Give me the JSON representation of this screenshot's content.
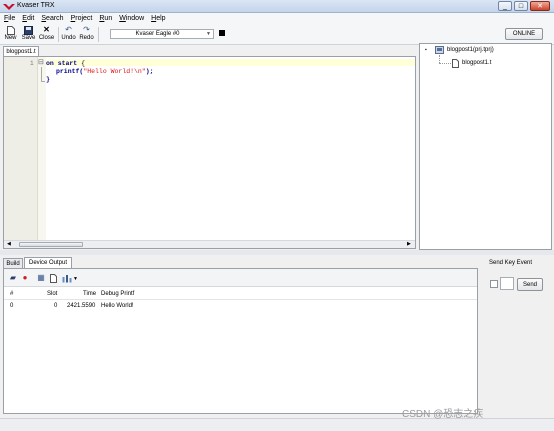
{
  "window": {
    "title": "Kvaser TRX",
    "min": "_",
    "max": "□",
    "close": "✕"
  },
  "menu": [
    "File",
    "Edit",
    "Search",
    "Project",
    "Run",
    "Window",
    "Help"
  ],
  "toolbar": {
    "new_label": "New",
    "save_label": "Save",
    "close_label": "Close",
    "undo_label": "Undo",
    "redo_label": "Redo",
    "device": "Kvaser Eagle #0",
    "online_label": "ONLINE"
  },
  "editor": {
    "tab": "blogpost1.t",
    "line_number": "1",
    "fold_open": "⊟",
    "lines": [
      {
        "kw": "on start",
        "rest": " {"
      },
      {
        "fn": "printf(",
        "str": "\"Hello World!\\n\"",
        "end": ");"
      },
      {
        "text": "}"
      }
    ]
  },
  "project": {
    "root": "blogpost1(prj.tprj)",
    "file": "blogpost1.t",
    "toggle": "▪"
  },
  "bottom": {
    "tabs": [
      "Build",
      "Device Output"
    ],
    "columns": [
      "#",
      "Slot",
      "Time",
      "Debug Printf"
    ],
    "rows": [
      {
        "num": "0",
        "slot": "0",
        "time": "2421.5590",
        "msg": "Hello World!"
      }
    ]
  },
  "send_key": {
    "title": "Send Key Event",
    "send_label": "Send"
  },
  "watermark": "CSDN @恐志之疾",
  "colors": {
    "keyword": "#00008b",
    "string": "#dd1111",
    "current_line": "#ffffd8"
  }
}
